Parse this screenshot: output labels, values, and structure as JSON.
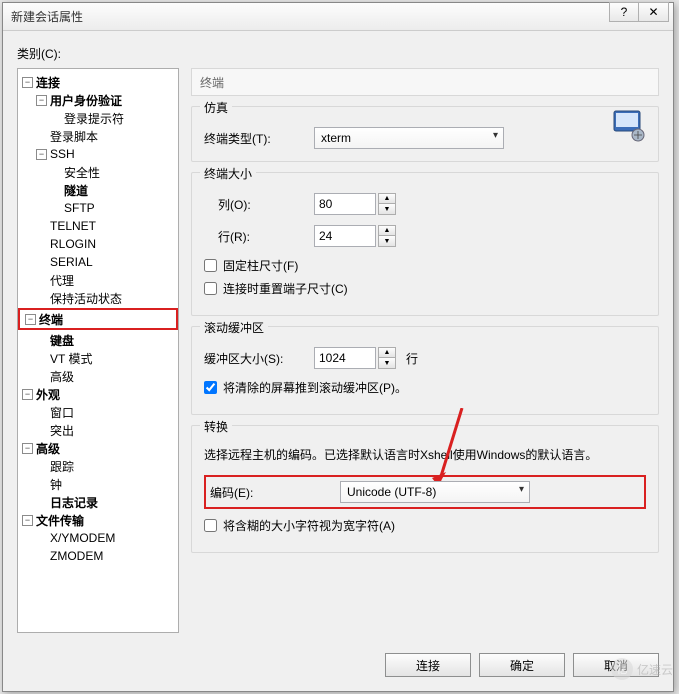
{
  "dialog": {
    "title": "新建会话属性",
    "help_symbol": "?",
    "close_symbol": "✕"
  },
  "category": {
    "label": "类别(C):"
  },
  "tree": {
    "connection": "连接",
    "auth": "用户身份验证",
    "login_prompt": "登录提示符",
    "login_script": "登录脚本",
    "ssh": "SSH",
    "security": "安全性",
    "tunnel": "隧道",
    "sftp": "SFTP",
    "telnet": "TELNET",
    "rlogin": "RLOGIN",
    "serial": "SERIAL",
    "proxy": "代理",
    "keepalive": "保持活动状态",
    "terminal": "终端",
    "keyboard": "键盘",
    "vtmode": "VT 模式",
    "advanced": "高级",
    "appearance": "外观",
    "window": "窗口",
    "highlight": "突出",
    "advanced2": "高级",
    "trace": "跟踪",
    "bell": "钟",
    "logging": "日志记录",
    "filetransfer": "文件传输",
    "xymodem": "X/YMODEM",
    "zmodem": "ZMODEM"
  },
  "panel": {
    "header": "终端",
    "emulation": {
      "title": "仿真",
      "type_label": "终端类型(T):",
      "type_value": "xterm"
    },
    "size": {
      "title": "终端大小",
      "cols_label": "列(O):",
      "cols_value": "80",
      "rows_label": "行(R):",
      "rows_value": "24",
      "fixed_label": "固定柱尺寸(F)",
      "resize_label": "连接时重置端子尺寸(C)"
    },
    "scrollback": {
      "title": "滚动缓冲区",
      "size_label": "缓冲区大小(S):",
      "size_value": "1024",
      "unit": "行",
      "push_label": "将清除的屏幕推到滚动缓冲区(P)。",
      "push_checked": true
    },
    "translation": {
      "title": "转换",
      "info": "选择远程主机的编码。已选择默认语言时Xshell使用Windows的默认语言。",
      "encoding_label": "编码(E):",
      "encoding_value": "Unicode (UTF-8)",
      "ambiguous_label": "将含糊的大小字符视为宽字符(A)"
    }
  },
  "buttons": {
    "connect": "连接",
    "ok": "确定",
    "cancel": "取消"
  },
  "watermark": "亿速云"
}
